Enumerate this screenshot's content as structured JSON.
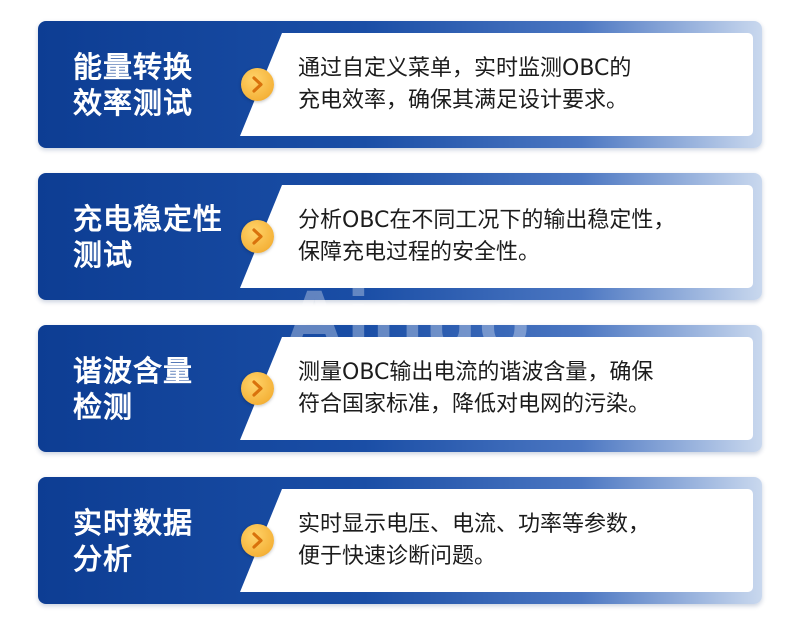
{
  "cards": [
    {
      "title_lines": [
        "能量转换",
        "效率测试"
      ],
      "desc_lines": [
        "通过自定义菜单，实时监测OBC的",
        "充电效率，确保其满足设计要求。"
      ]
    },
    {
      "title_lines": [
        "充电稳定性",
        "测试"
      ],
      "desc_lines": [
        "分析OBC在不同工况下的输出稳定性，",
        "保障充电过程的安全性。"
      ]
    },
    {
      "title_lines": [
        "谐波含量",
        "检测"
      ],
      "desc_lines": [
        "测量OBC输出电流的谐波含量，确保",
        "符合国家标准，降低对电网的污染。"
      ]
    },
    {
      "title_lines": [
        "实时数据",
        "分析"
      ],
      "desc_lines": [
        "实时显示电压、电流、功率等参数，",
        "便于快速诊断问题。"
      ]
    }
  ],
  "watermark": "Ainuo",
  "colors": {
    "card_blue": "#0d3d93",
    "badge_orange": "#f5b33a",
    "chevron": "#e07a10"
  },
  "icon": "chevron-right-icon"
}
